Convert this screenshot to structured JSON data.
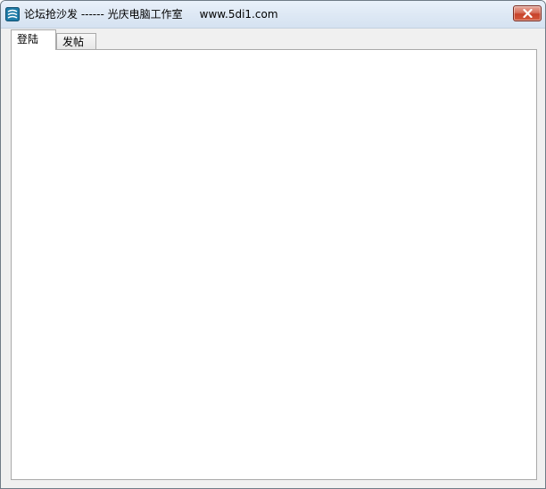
{
  "window": {
    "title": "论坛抢沙发 ------ 光庆电脑工作室     www.5di1.com",
    "icon": "app-icon",
    "close_icon": "close-icon"
  },
  "tabs": [
    {
      "label": "登陆",
      "selected": true
    },
    {
      "label": "发帖",
      "selected": false
    }
  ],
  "colors": {
    "titlebar": "#dfe9f5",
    "close_button": "#c7422a",
    "panel": "#ffffff",
    "window_bg": "#f0f0f0"
  }
}
